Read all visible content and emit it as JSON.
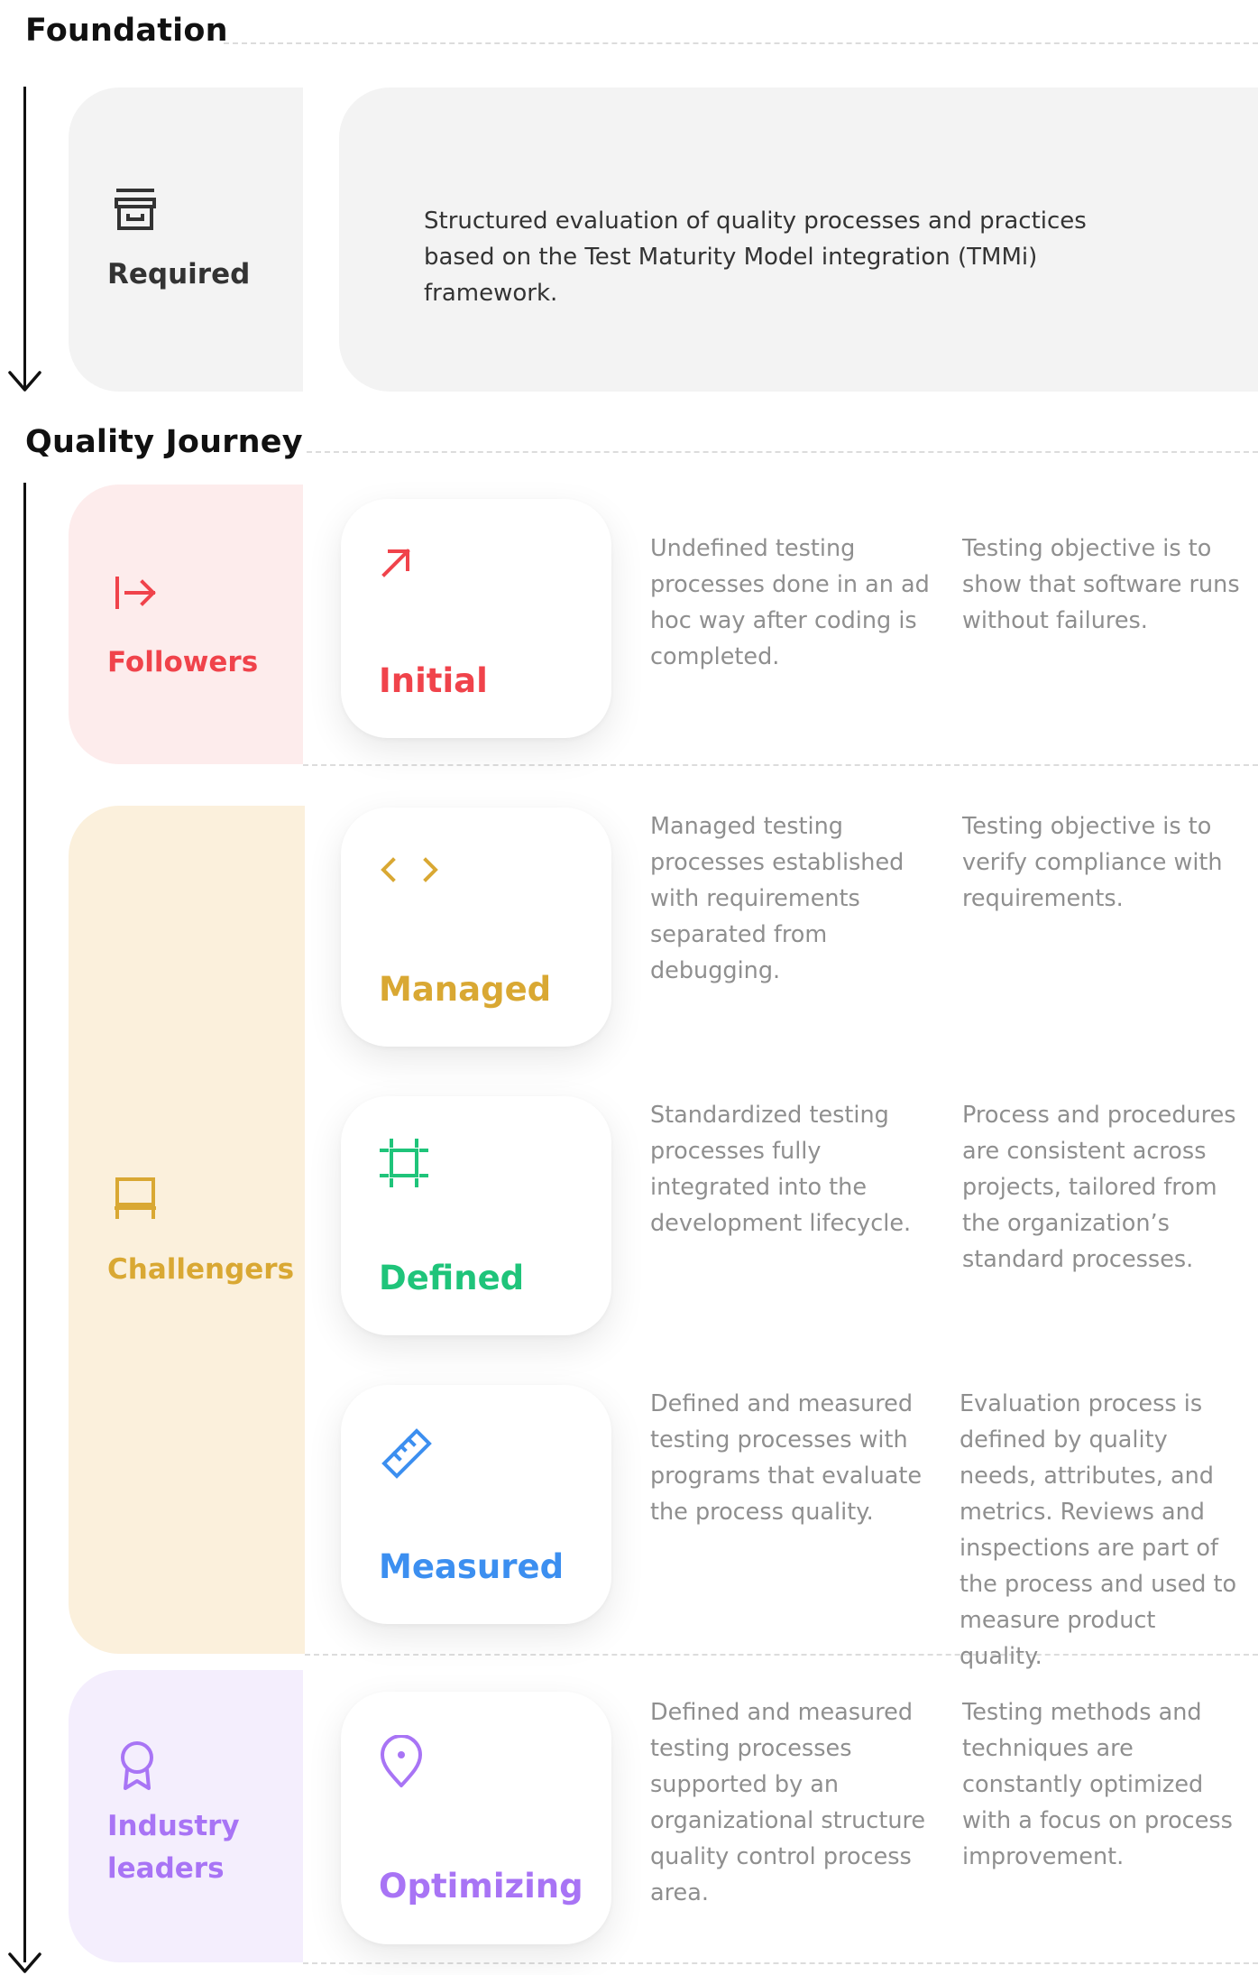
{
  "foundation": {
    "title": "Foundation",
    "category": "Required",
    "description": "Structured evaluation of quality processes and practices based on the Test Maturity Model integration (TMMi) framework."
  },
  "journey": {
    "title": "Quality Journey",
    "categories": [
      {
        "label": "Followers",
        "color": "#f0434b",
        "bg": "#fdecec"
      },
      {
        "label": "Challengers",
        "color": "#d9a833",
        "bg": "#fbf0dc"
      },
      {
        "label": "Industry leaders",
        "color": "#a874f5",
        "bg": "#f4eefd"
      }
    ],
    "levels": [
      {
        "title": "Initial",
        "color": "#f0434b",
        "icon": "arrow-up-right-icon",
        "description": "Undefined testing processes done in an ad hoc way after coding is completed.",
        "objective": "Testing objective is to show that software runs without failures."
      },
      {
        "title": "Managed",
        "color": "#d9a833",
        "icon": "code-brackets-icon",
        "description": "Managed testing processes established with requirements separated from debugging.",
        "objective": "Testing objective is to verify compliance with requirements."
      },
      {
        "title": "Defined",
        "color": "#1fc47a",
        "icon": "frame-icon",
        "description": "Standardized testing processes  fully integrated into the development lifecycle.",
        "objective": "Process and procedures are consistent across projects, tailored from the organization’s standard processes."
      },
      {
        "title": "Measured",
        "color": "#3c8ff0",
        "icon": "ruler-icon",
        "description": "Defined and measured testing processes with programs that evaluate the process quality.",
        "objective": "Evaluation process is defined by quality needs, attributes, and metrics. Reviews and inspections are part of the process and used to measure product quality."
      },
      {
        "title": "Optimizing",
        "color": "#a874f5",
        "icon": "location-pin-icon",
        "description": "Defined and measured testing processes supported by an organizational structure quality control process area.",
        "objective": "Testing methods and techniques are constantly optimized with a focus on process improvement."
      }
    ]
  }
}
